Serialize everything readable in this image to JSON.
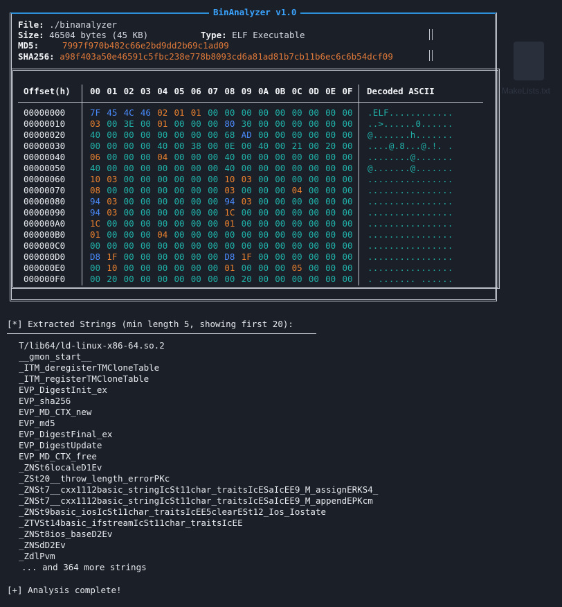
{
  "window_title": "BinAnalyzer v1.0",
  "file_info": {
    "file_label": "File:",
    "file_value": "./binanalyzer",
    "size_label": "Size:",
    "size_value": "46504 bytes (45 KB)",
    "type_label": "Type:",
    "type_value": "ELF Executable",
    "md5_label": "MD5:",
    "md5_value": "7997f970b482c66e2bd9dd2b69c1ad09",
    "sha256_label": "SHA256:",
    "sha256_value": "a98f403a50e46591c5fbc238e778b8093cd6a81ad81b7cb11b6ec6c6b54dcf09"
  },
  "hex_view": {
    "offset_header": "Offset(h)",
    "columns": [
      "00",
      "01",
      "02",
      "03",
      "04",
      "05",
      "06",
      "07",
      "08",
      "09",
      "0A",
      "0B",
      "0C",
      "0D",
      "0E",
      "0F"
    ],
    "ascii_header": "Decoded ASCII",
    "rows": [
      {
        "offset": "00000000",
        "bytes": [
          "7F",
          "45",
          "4C",
          "46",
          "02",
          "01",
          "01",
          "00",
          "00",
          "00",
          "00",
          "00",
          "00",
          "00",
          "00",
          "00"
        ],
        "ascii": ".ELF............"
      },
      {
        "offset": "00000010",
        "bytes": [
          "03",
          "00",
          "3E",
          "00",
          "01",
          "00",
          "00",
          "00",
          "80",
          "30",
          "00",
          "00",
          "00",
          "00",
          "00",
          "00"
        ],
        "ascii": "..>......0......"
      },
      {
        "offset": "00000020",
        "bytes": [
          "40",
          "00",
          "00",
          "00",
          "00",
          "00",
          "00",
          "00",
          "68",
          "AD",
          "00",
          "00",
          "00",
          "00",
          "00",
          "00"
        ],
        "ascii": "@.......h......."
      },
      {
        "offset": "00000030",
        "bytes": [
          "00",
          "00",
          "00",
          "00",
          "40",
          "00",
          "38",
          "00",
          "0E",
          "00",
          "40",
          "00",
          "21",
          "00",
          "20",
          "00"
        ],
        "ascii": "....@.8...@.!. ."
      },
      {
        "offset": "00000040",
        "bytes": [
          "06",
          "00",
          "00",
          "00",
          "04",
          "00",
          "00",
          "00",
          "40",
          "00",
          "00",
          "00",
          "00",
          "00",
          "00",
          "00"
        ],
        "ascii": "........@......."
      },
      {
        "offset": "00000050",
        "bytes": [
          "40",
          "00",
          "00",
          "00",
          "00",
          "00",
          "00",
          "00",
          "40",
          "00",
          "00",
          "00",
          "00",
          "00",
          "00",
          "00"
        ],
        "ascii": "@.......@......."
      },
      {
        "offset": "00000060",
        "bytes": [
          "10",
          "03",
          "00",
          "00",
          "00",
          "00",
          "00",
          "00",
          "10",
          "03",
          "00",
          "00",
          "00",
          "00",
          "00",
          "00"
        ],
        "ascii": "................"
      },
      {
        "offset": "00000070",
        "bytes": [
          "08",
          "00",
          "00",
          "00",
          "00",
          "00",
          "00",
          "00",
          "03",
          "00",
          "00",
          "00",
          "04",
          "00",
          "00",
          "00"
        ],
        "ascii": "................"
      },
      {
        "offset": "00000080",
        "bytes": [
          "94",
          "03",
          "00",
          "00",
          "00",
          "00",
          "00",
          "00",
          "94",
          "03",
          "00",
          "00",
          "00",
          "00",
          "00",
          "00"
        ],
        "ascii": "................"
      },
      {
        "offset": "00000090",
        "bytes": [
          "94",
          "03",
          "00",
          "00",
          "00",
          "00",
          "00",
          "00",
          "1C",
          "00",
          "00",
          "00",
          "00",
          "00",
          "00",
          "00"
        ],
        "ascii": "................"
      },
      {
        "offset": "000000A0",
        "bytes": [
          "1C",
          "00",
          "00",
          "00",
          "00",
          "00",
          "00",
          "00",
          "01",
          "00",
          "00",
          "00",
          "00",
          "00",
          "00",
          "00"
        ],
        "ascii": "................"
      },
      {
        "offset": "000000B0",
        "bytes": [
          "01",
          "00",
          "00",
          "00",
          "04",
          "00",
          "00",
          "00",
          "00",
          "00",
          "00",
          "00",
          "00",
          "00",
          "00",
          "00"
        ],
        "ascii": "................"
      },
      {
        "offset": "000000C0",
        "bytes": [
          "00",
          "00",
          "00",
          "00",
          "00",
          "00",
          "00",
          "00",
          "00",
          "00",
          "00",
          "00",
          "00",
          "00",
          "00",
          "00"
        ],
        "ascii": "................"
      },
      {
        "offset": "000000D0",
        "bytes": [
          "D8",
          "1F",
          "00",
          "00",
          "00",
          "00",
          "00",
          "00",
          "D8",
          "1F",
          "00",
          "00",
          "00",
          "00",
          "00",
          "00"
        ],
        "ascii": "................"
      },
      {
        "offset": "000000E0",
        "bytes": [
          "00",
          "10",
          "00",
          "00",
          "00",
          "00",
          "00",
          "00",
          "01",
          "00",
          "00",
          "00",
          "05",
          "00",
          "00",
          "00"
        ],
        "ascii": "................"
      },
      {
        "offset": "000000F0",
        "bytes": [
          "00",
          "20",
          "00",
          "00",
          "00",
          "00",
          "00",
          "00",
          "00",
          "20",
          "00",
          "00",
          "00",
          "00",
          "00",
          "00"
        ],
        "ascii": ". ....... ......"
      }
    ]
  },
  "strings_section": {
    "title": "[*] Extracted Strings (min length 5, showing first 20):",
    "items": [
      "T/lib64/ld-linux-x86-64.so.2",
      "__gmon_start__",
      "_ITM_deregisterTMCloneTable",
      "_ITM_registerTMCloneTable",
      "EVP_DigestInit_ex",
      "EVP_sha256",
      "EVP_MD_CTX_new",
      "EVP_md5",
      "EVP_DigestFinal_ex",
      "EVP_DigestUpdate",
      "EVP_MD_CTX_free",
      "_ZNSt6localeD1Ev",
      "_ZSt20__throw_length_errorPKc",
      "_ZNSt7__cxx1112basic_stringIcSt11char_traitsIcESaIcEE9_M_assignERKS4_",
      "_ZNSt7__cxx1112basic_stringIcSt11char_traitsIcESaIcEE9_M_appendEPKcm",
      "_ZNSt9basic_iosIcSt11char_traitsIcEE5clearESt12_Ios_Iostate",
      "_ZTVSt14basic_ifstreamIcSt11char_traitsIcEE",
      "_ZNSt8ios_baseD2Ev",
      "_ZNSdD2Ev",
      "_ZdlPvm"
    ],
    "more": "... and 364 more strings"
  },
  "status": "[+] Analysis complete!",
  "colors": {
    "accent": "#3aa3ff",
    "zero": "#20b2aa",
    "highlight": "#e8802f",
    "ptr": "#4a8cff",
    "bg": "#1b1f27"
  }
}
